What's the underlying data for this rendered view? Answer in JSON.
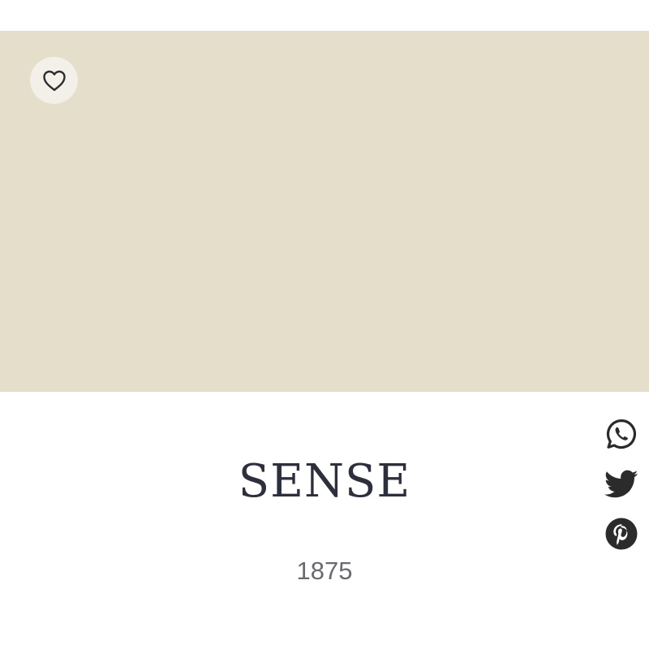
{
  "swatch": {
    "color": "#e5decb"
  },
  "favorite": {
    "icon": "heart-outline-icon"
  },
  "product": {
    "name": "SENSE",
    "code": "1875"
  },
  "share": {
    "icons": [
      "whatsapp-icon",
      "twitter-icon",
      "pinterest-icon"
    ],
    "icon_color": "#2b2b2b"
  }
}
